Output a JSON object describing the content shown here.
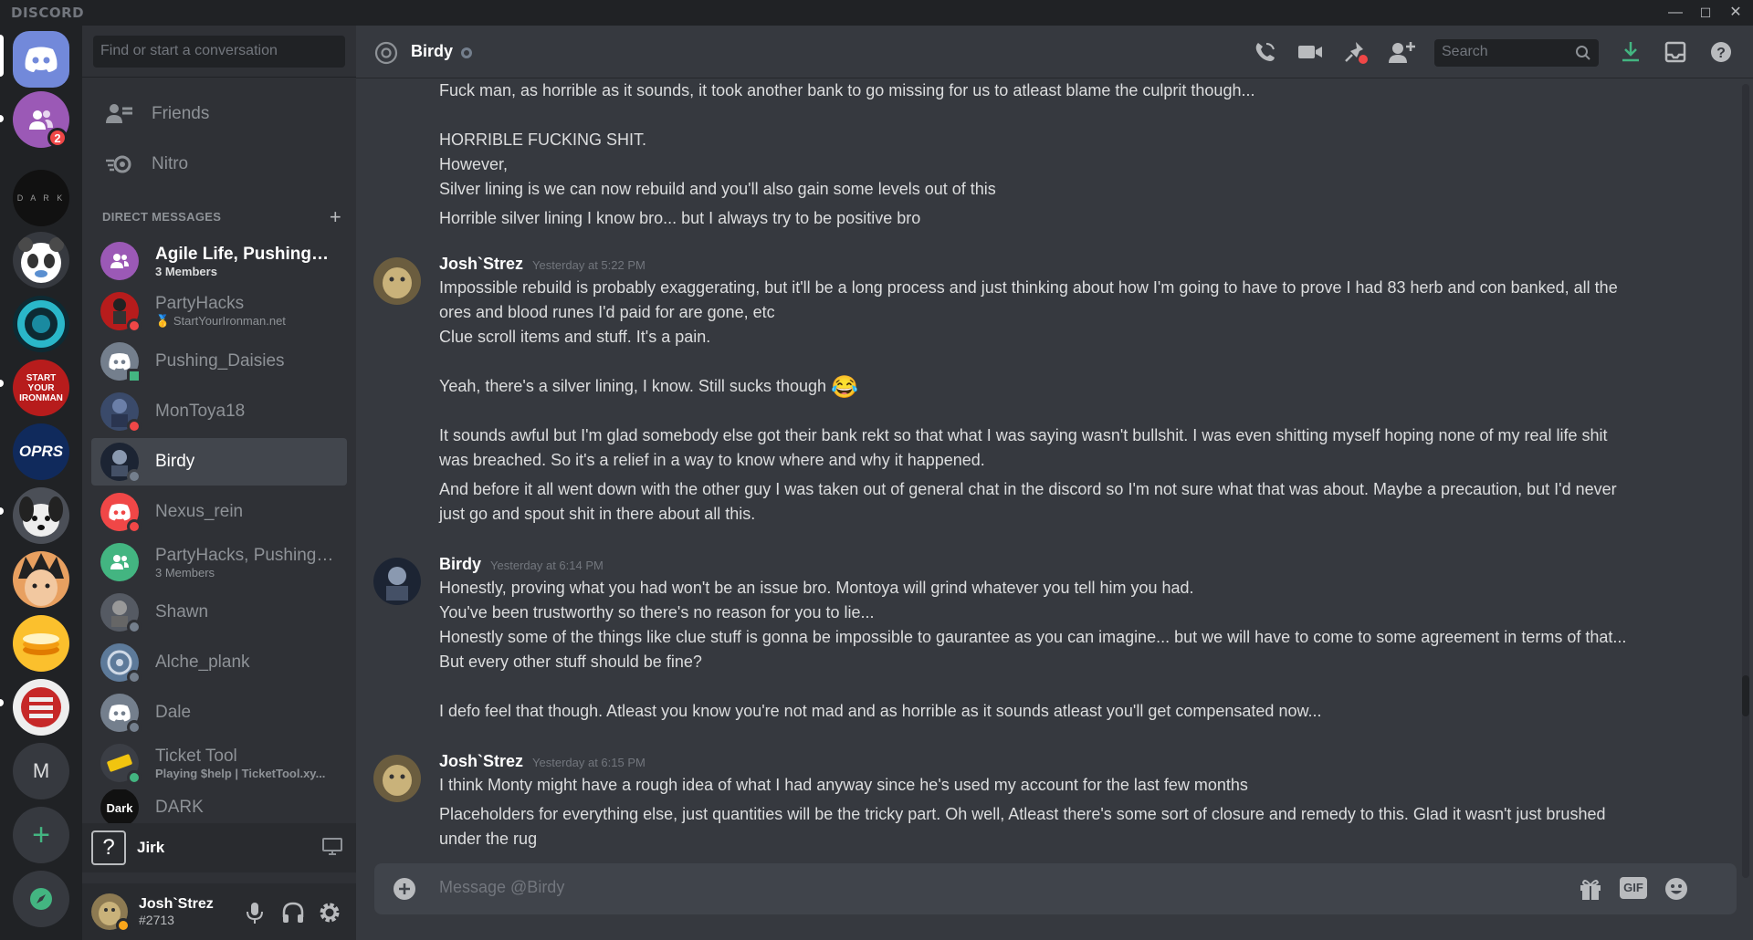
{
  "window": {
    "brand": "DISCORD",
    "minimize": "—",
    "maximize": "☐",
    "close": "✕"
  },
  "servers": {
    "home_badge": "2",
    "m_label": "M",
    "add_label": "+",
    "dark_label": "D A R K",
    "oprs_label": "OPRS",
    "syi_label": "START YOUR IRONMAN"
  },
  "dm_sidebar": {
    "search_placeholder": "Find or start a conversation",
    "friends_label": "Friends",
    "nitro_label": "Nitro",
    "direct_messages_header": "DIRECT MESSAGES",
    "add_dm": "+",
    "items": [
      {
        "name": "Agile Life, Pushing_D...",
        "sub": "3 Members",
        "bright": true
      },
      {
        "name": "PartyHacks",
        "sub": "StartYourIronman.net"
      },
      {
        "name": "Pushing_Daisies",
        "sub": ""
      },
      {
        "name": "MonToya18",
        "sub": ""
      },
      {
        "name": "Birdy",
        "sub": ""
      },
      {
        "name": "Nexus_rein",
        "sub": ""
      },
      {
        "name": "PartyHacks, Pushing_...",
        "sub": "3 Members"
      },
      {
        "name": "Shawn",
        "sub": ""
      },
      {
        "name": "Alche_plank",
        "sub": ""
      },
      {
        "name": "Dale",
        "sub": ""
      },
      {
        "name": "Ticket Tool",
        "sub": "Playing $help | TicketTool.xy..."
      },
      {
        "name": "DARK",
        "sub": ""
      }
    ],
    "dark_avatar_text": "Dark",
    "jirk_label": "Jirk",
    "jirk_icon_text": "?",
    "user_name": "Josh`Strez",
    "user_tag": "#2713"
  },
  "chat": {
    "channel_name": "Birdy",
    "search_placeholder": "Search",
    "composer_placeholder": "Message @Birdy",
    "gif_label": "GIF",
    "lines_top": [
      "Fuck man, as horrible as it sounds, it took another bank to go missing for us to atleast blame the culprit though...",
      "HORRIBLE FUCKING SHIT.",
      "However,",
      "Silver lining is we can now rebuild and you'll also gain some levels out of this",
      "Horrible silver lining I know bro... but I always try to be positive bro"
    ],
    "group1": {
      "author": "Josh`Strez",
      "time": "Yesterday at 5:22 PM",
      "lines": [
        "Impossible rebuild is probably exaggerating, but it'll be a long process and just thinking about how I'm going to have to prove I had 83 herb and con banked, all the",
        "ores and blood runes I'd paid for are gone, etc",
        "Clue scroll items and stuff. It's a pain.",
        "Yeah, there's a silver lining, I know. Still sucks though",
        "It sounds awful but I'm glad somebody else got their bank rekt so that what I was saying wasn't bullshit. I was even shitting myself hoping none of my real life shit",
        "was breached. So it's a relief in a way to know where and why it happened.",
        "And before it all went down with the other guy I was taken out of general chat in the discord so I'm not sure what that was about. Maybe a precaution, but I'd never",
        "just go and spout shit in there about all this."
      ]
    },
    "group2": {
      "author": "Birdy",
      "time": "Yesterday at 6:14 PM",
      "lines": [
        "Honestly, proving what you had won't be an issue bro. Montoya will grind whatever you tell him you had.",
        "You've been trustworthy so there's no reason for you to lie...",
        "Honestly some of the things like clue stuff is gonna be impossible to gaurantee as you can imagine... but we will have to come to some agreement in terms of that...",
        "But every other stuff should be fine?",
        "I defo feel that though. Atleast you know you're not mad and as horrible as it sounds atleast you'll get compensated now..."
      ]
    },
    "group3": {
      "author": "Josh`Strez",
      "time": "Yesterday at 6:15 PM",
      "lines": [
        "I think Monty might have a rough idea of what I had anyway since he's used my account for the last few months",
        "Placeholders for everything else, just quantities will be the tricky part. Oh well, Atleast there's some sort of closure and remedy to this. Glad it wasn't just brushed",
        "under the rug"
      ]
    },
    "emoji_laugh": "😂"
  },
  "colors": {
    "blurple": "#7289da",
    "online": "#43b581",
    "dnd": "#f04747",
    "idle": "#faa61a",
    "offline": "#747f8d"
  }
}
